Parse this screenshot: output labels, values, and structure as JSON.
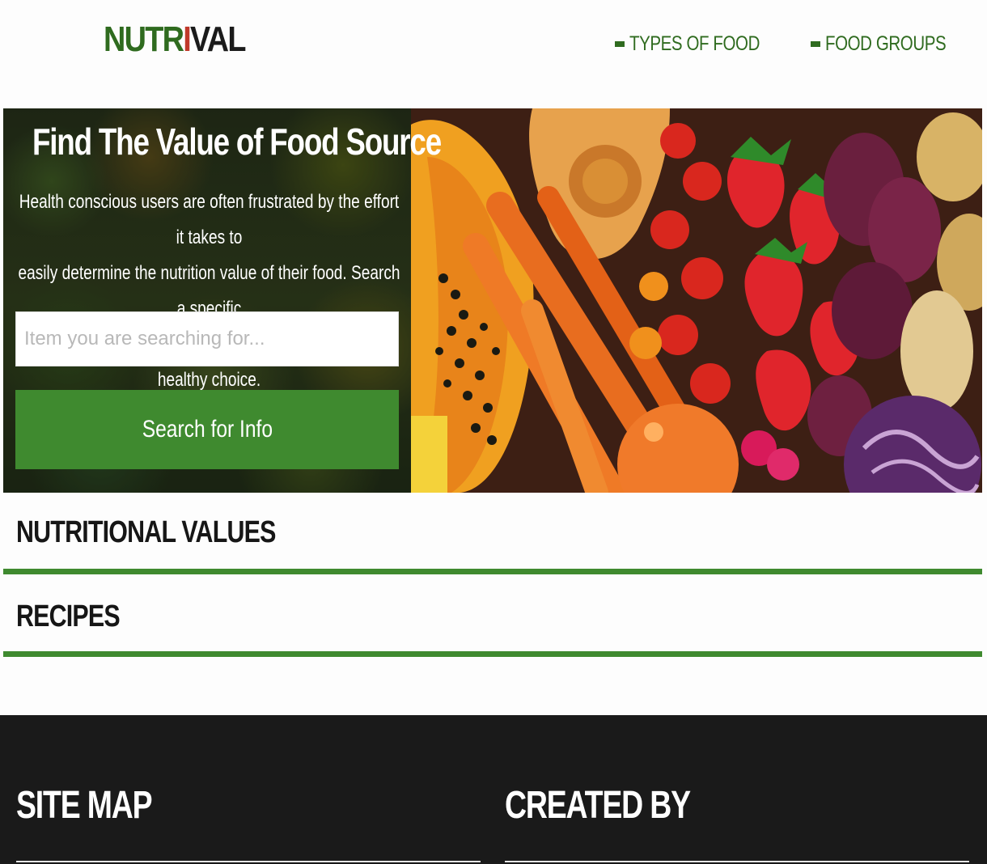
{
  "header": {
    "logo": {
      "part1": "NUTR",
      "part2": "I",
      "part3": "VAL"
    },
    "nav": [
      {
        "label": "TYPES OF FOOD",
        "icon": "square-bullet-icon"
      },
      {
        "label": "FOOD GROUPS",
        "icon": "square-bullet-icon"
      }
    ]
  },
  "hero": {
    "title": "Find The Value of Food Source",
    "description_lines": [
      "Health conscious users are often frustrated by the effort it takes to",
      "easily determine the nutrition value of their food. Search a specific",
      "food item and get all the info you need to make a healthy choice."
    ],
    "search": {
      "placeholder": "Item you are searching for...",
      "value": ""
    },
    "button_label": "Search for Info"
  },
  "sections": [
    {
      "title": "NUTRITIONAL VALUES"
    },
    {
      "title": "RECIPES"
    }
  ],
  "footer": {
    "columns": [
      {
        "title": "SITE MAP"
      },
      {
        "title": "CREATED BY"
      }
    ]
  },
  "colors": {
    "brand_green": "#2f6b1f",
    "accent_green": "#3f8a2f",
    "logo_red": "#c0392b",
    "footer_bg": "#1a1a1a"
  }
}
